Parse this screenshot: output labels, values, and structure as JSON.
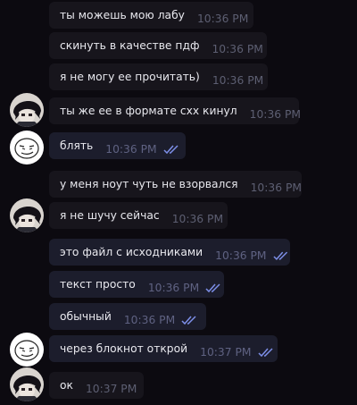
{
  "colors": {
    "background": "#0c0a10",
    "incoming_bubble": "#17151c",
    "outgoing_bubble": "#1c1d2c",
    "check_color": "#7d8fe8"
  },
  "messages": [
    {
      "text": "ты можешь мою лабу",
      "time": "10:36 PM",
      "side": "in"
    },
    {
      "text": "скинуть в качестве пдф",
      "time": "10:36 PM",
      "side": "in"
    },
    {
      "text": "я не могу ее прочитать)",
      "time": "10:36 PM",
      "side": "in"
    },
    {
      "text": "ты же ее в формате cxx кинул",
      "time": "10:36 PM",
      "side": "in",
      "avatar": "dark-haired-avatar"
    },
    {
      "text": "блять",
      "time": "10:36 PM",
      "side": "out",
      "check": "double-check-icon",
      "avatar": "sketch-face-avatar"
    },
    {
      "text": "у меня ноут чуть не взорвался",
      "time": "10:36 PM",
      "side": "in"
    },
    {
      "text": "я не шучу сейчас",
      "time": "10:36 PM",
      "side": "in",
      "avatar": "dark-haired-avatar"
    },
    {
      "text": "это файл с исходниками",
      "time": "10:36 PM",
      "side": "out",
      "check": "double-check-icon"
    },
    {
      "text": "текст просто",
      "time": "10:36 PM",
      "side": "out",
      "check": "double-check-icon"
    },
    {
      "text": "обычный",
      "time": "10:36 PM",
      "side": "out",
      "check": "double-check-icon"
    },
    {
      "text": "через блокнот открой",
      "time": "10:37 PM",
      "side": "out",
      "check": "double-check-icon",
      "avatar": "sketch-face-avatar"
    },
    {
      "text": "ок",
      "time": "10:37 PM",
      "side": "in",
      "avatar": "dark-haired-avatar"
    }
  ]
}
